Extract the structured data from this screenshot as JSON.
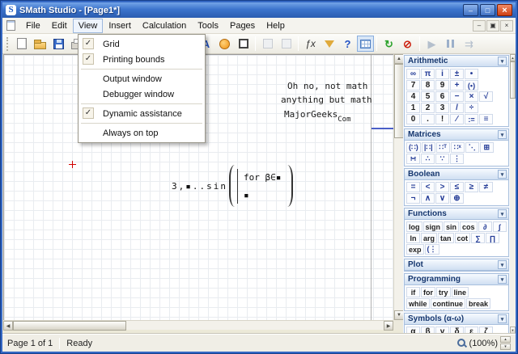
{
  "window": {
    "title": "SMath Studio - [Page1*]",
    "logo": "S"
  },
  "icons": {
    "minimize": "–",
    "maximize": "□",
    "close": "×",
    "mdi_minimize": "–",
    "mdi_restore": "▣",
    "mdi_close": "×",
    "check": "✓",
    "chevron_down": "▾",
    "cut": "✂",
    "undo": "↶",
    "redo": "↷",
    "font": "A",
    "fx": "ƒx",
    "question": "?",
    "refresh": "↻",
    "stop": "⊘",
    "play": "▶",
    "step": "⇉",
    "up": "▲",
    "down": "▼",
    "left": "◀",
    "right": "▶",
    "spin_up": "▴",
    "spin_down": "▾"
  },
  "menu": {
    "items": [
      "File",
      "Edit",
      "View",
      "Insert",
      "Calculation",
      "Tools",
      "Pages",
      "Help"
    ]
  },
  "view_menu": [
    {
      "label": "Grid",
      "checked": true
    },
    {
      "label": "Printing bounds",
      "checked": true
    },
    {
      "label": "Output window",
      "checked": false
    },
    {
      "label": "Debugger window",
      "checked": false
    },
    {
      "label": "Dynamic assistance",
      "checked": true
    },
    {
      "label": "Always on top",
      "checked": false
    }
  ],
  "canvas": {
    "note_line1": "Oh no, not math",
    "note_line2": "anything but math",
    "brand": "MajorGeeks",
    "brand_sub": "Com",
    "expr_prefix": "3,▪..sin",
    "expr_line1": "for β∈▪",
    "expr_line2": "▪"
  },
  "sidebar": {
    "panels": [
      {
        "title": "Arithmetic",
        "rows": [
          [
            "∞",
            "π",
            "i",
            "±",
            "•"
          ],
          [
            "7",
            "8",
            "9",
            "+",
            "(•)"
          ],
          [
            "4",
            "5",
            "6",
            "−",
            "×",
            "√"
          ],
          [
            "1",
            "2",
            "3",
            "/",
            "÷"
          ],
          [
            "0",
            ".",
            "!",
            "⁄",
            ":=",
            "≡"
          ]
        ]
      },
      {
        "title": "Matrices",
        "rows": [
          [
            "(∷)",
            "|∷|",
            "∷ᵀ",
            "∷ˣ",
            "⋱",
            "⊞"
          ],
          [
            "∺",
            "∴",
            "∵",
            "⋮"
          ]
        ]
      },
      {
        "title": "Boolean",
        "rows": [
          [
            "=",
            "<",
            ">",
            "≤",
            "≥",
            "≠"
          ],
          [
            "¬",
            "∧",
            "∨",
            "⊕"
          ]
        ]
      },
      {
        "title": "Functions",
        "rows": [
          [
            "log",
            "sign",
            "sin",
            "cos",
            "∂",
            "∫"
          ],
          [
            "ln",
            "arg",
            "tan",
            "cot",
            "∑",
            "∏"
          ],
          [
            "exp",
            "(⋮"
          ]
        ]
      },
      {
        "title": "Plot",
        "rows": []
      },
      {
        "title": "Programming",
        "rows": [
          [
            "if",
            "for",
            "try",
            "line"
          ],
          [
            "while",
            "continue",
            "break"
          ]
        ]
      },
      {
        "title": "Symbols (α-ω)",
        "rows": [
          [
            "α",
            "β",
            "γ",
            "δ",
            "ε",
            "ζ"
          ]
        ]
      }
    ]
  },
  "statusbar": {
    "page": "Page 1 of 1",
    "status": "Ready",
    "zoom": "(100%)"
  }
}
